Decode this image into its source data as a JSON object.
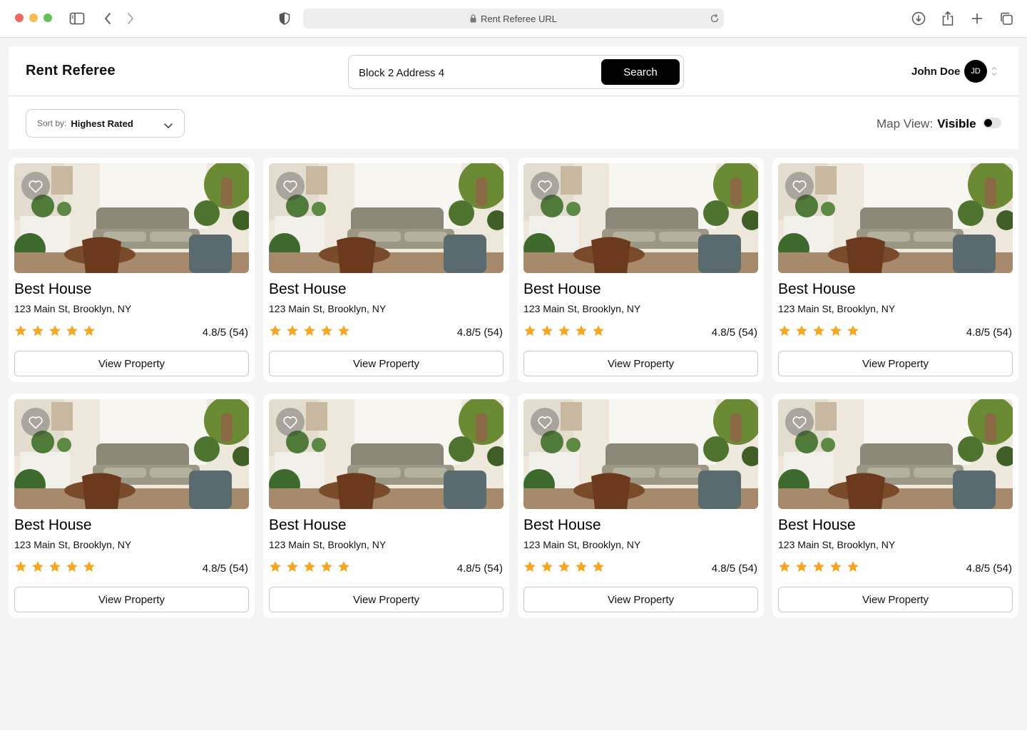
{
  "browser": {
    "url_text": "Rent Referee URL"
  },
  "header": {
    "brand": "Rent Referee",
    "search_value": "Block 2 Address 4",
    "search_button": "Search",
    "user_name": "John Doe",
    "user_initials": "JD"
  },
  "toolbar": {
    "sort_label": "Sort by:",
    "sort_value": "Highest Rated",
    "map_label": "Map View:",
    "map_value": "Visible"
  },
  "colors": {
    "accent": "#000000",
    "star": "#f5a623",
    "background": "#f4f4f4"
  },
  "listings": [
    {
      "title": "Best House",
      "address": "123 Main St, Brooklyn, NY",
      "stars": 5,
      "rating": "4.8/5 (54)",
      "button": "View Property"
    },
    {
      "title": "Best House",
      "address": "123 Main St, Brooklyn, NY",
      "stars": 5,
      "rating": "4.8/5 (54)",
      "button": "View Property"
    },
    {
      "title": "Best House",
      "address": "123 Main St, Brooklyn, NY",
      "stars": 5,
      "rating": "4.8/5 (54)",
      "button": "View Property"
    },
    {
      "title": "Best House",
      "address": "123 Main St, Brooklyn, NY",
      "stars": 5,
      "rating": "4.8/5 (54)",
      "button": "View Property"
    },
    {
      "title": "Best House",
      "address": "123 Main St, Brooklyn, NY",
      "stars": 5,
      "rating": "4.8/5 (54)",
      "button": "View Property"
    },
    {
      "title": "Best House",
      "address": "123 Main St, Brooklyn, NY",
      "stars": 5,
      "rating": "4.8/5 (54)",
      "button": "View Property"
    },
    {
      "title": "Best House",
      "address": "123 Main St, Brooklyn, NY",
      "stars": 5,
      "rating": "4.8/5 (54)",
      "button": "View Property"
    },
    {
      "title": "Best House",
      "address": "123 Main St, Brooklyn, NY",
      "stars": 5,
      "rating": "4.8/5 (54)",
      "button": "View Property"
    }
  ]
}
